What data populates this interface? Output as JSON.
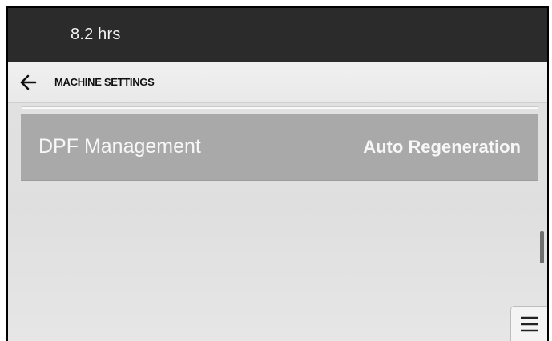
{
  "status_bar": {
    "hours": "8.2 hrs"
  },
  "nav": {
    "back_icon": "arrow-left-icon",
    "title": "MACHINE SETTINGS"
  },
  "settings": [
    {
      "label": "DPF Management",
      "value": "Auto Regeneration"
    }
  ],
  "menu": {
    "icon": "hamburger-menu-icon"
  },
  "colors": {
    "status_bar": "#2b2b2b",
    "row_background": "#a9a9a9",
    "content_background": "#e3e3e3",
    "text_light": "#f7f7f7"
  }
}
